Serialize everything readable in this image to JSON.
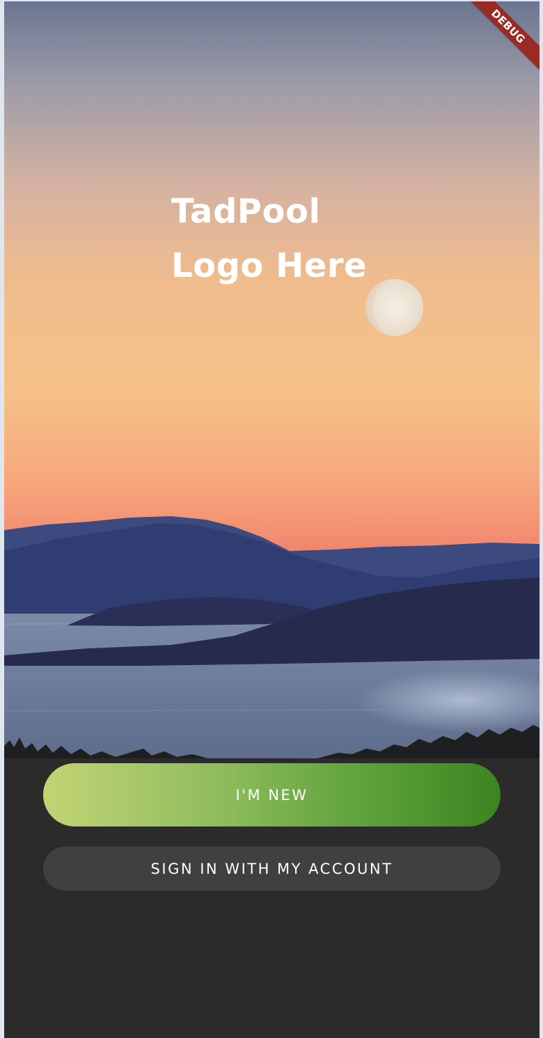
{
  "app": {
    "logo_line_1": "TadPool",
    "logo_line_2": "Logo Here"
  },
  "buttons": {
    "new_label": "I'M NEW",
    "signin_label": "SIGN IN WITH MY ACCOUNT"
  },
  "debug_banner": "DEBUG",
  "colors": {
    "new_button_gradient_start": "#c2d474",
    "new_button_gradient_end": "#3c8420",
    "signin_button": "#404040",
    "panel_background": "#2b2b2b",
    "debug_banner": "#9a2b24"
  }
}
